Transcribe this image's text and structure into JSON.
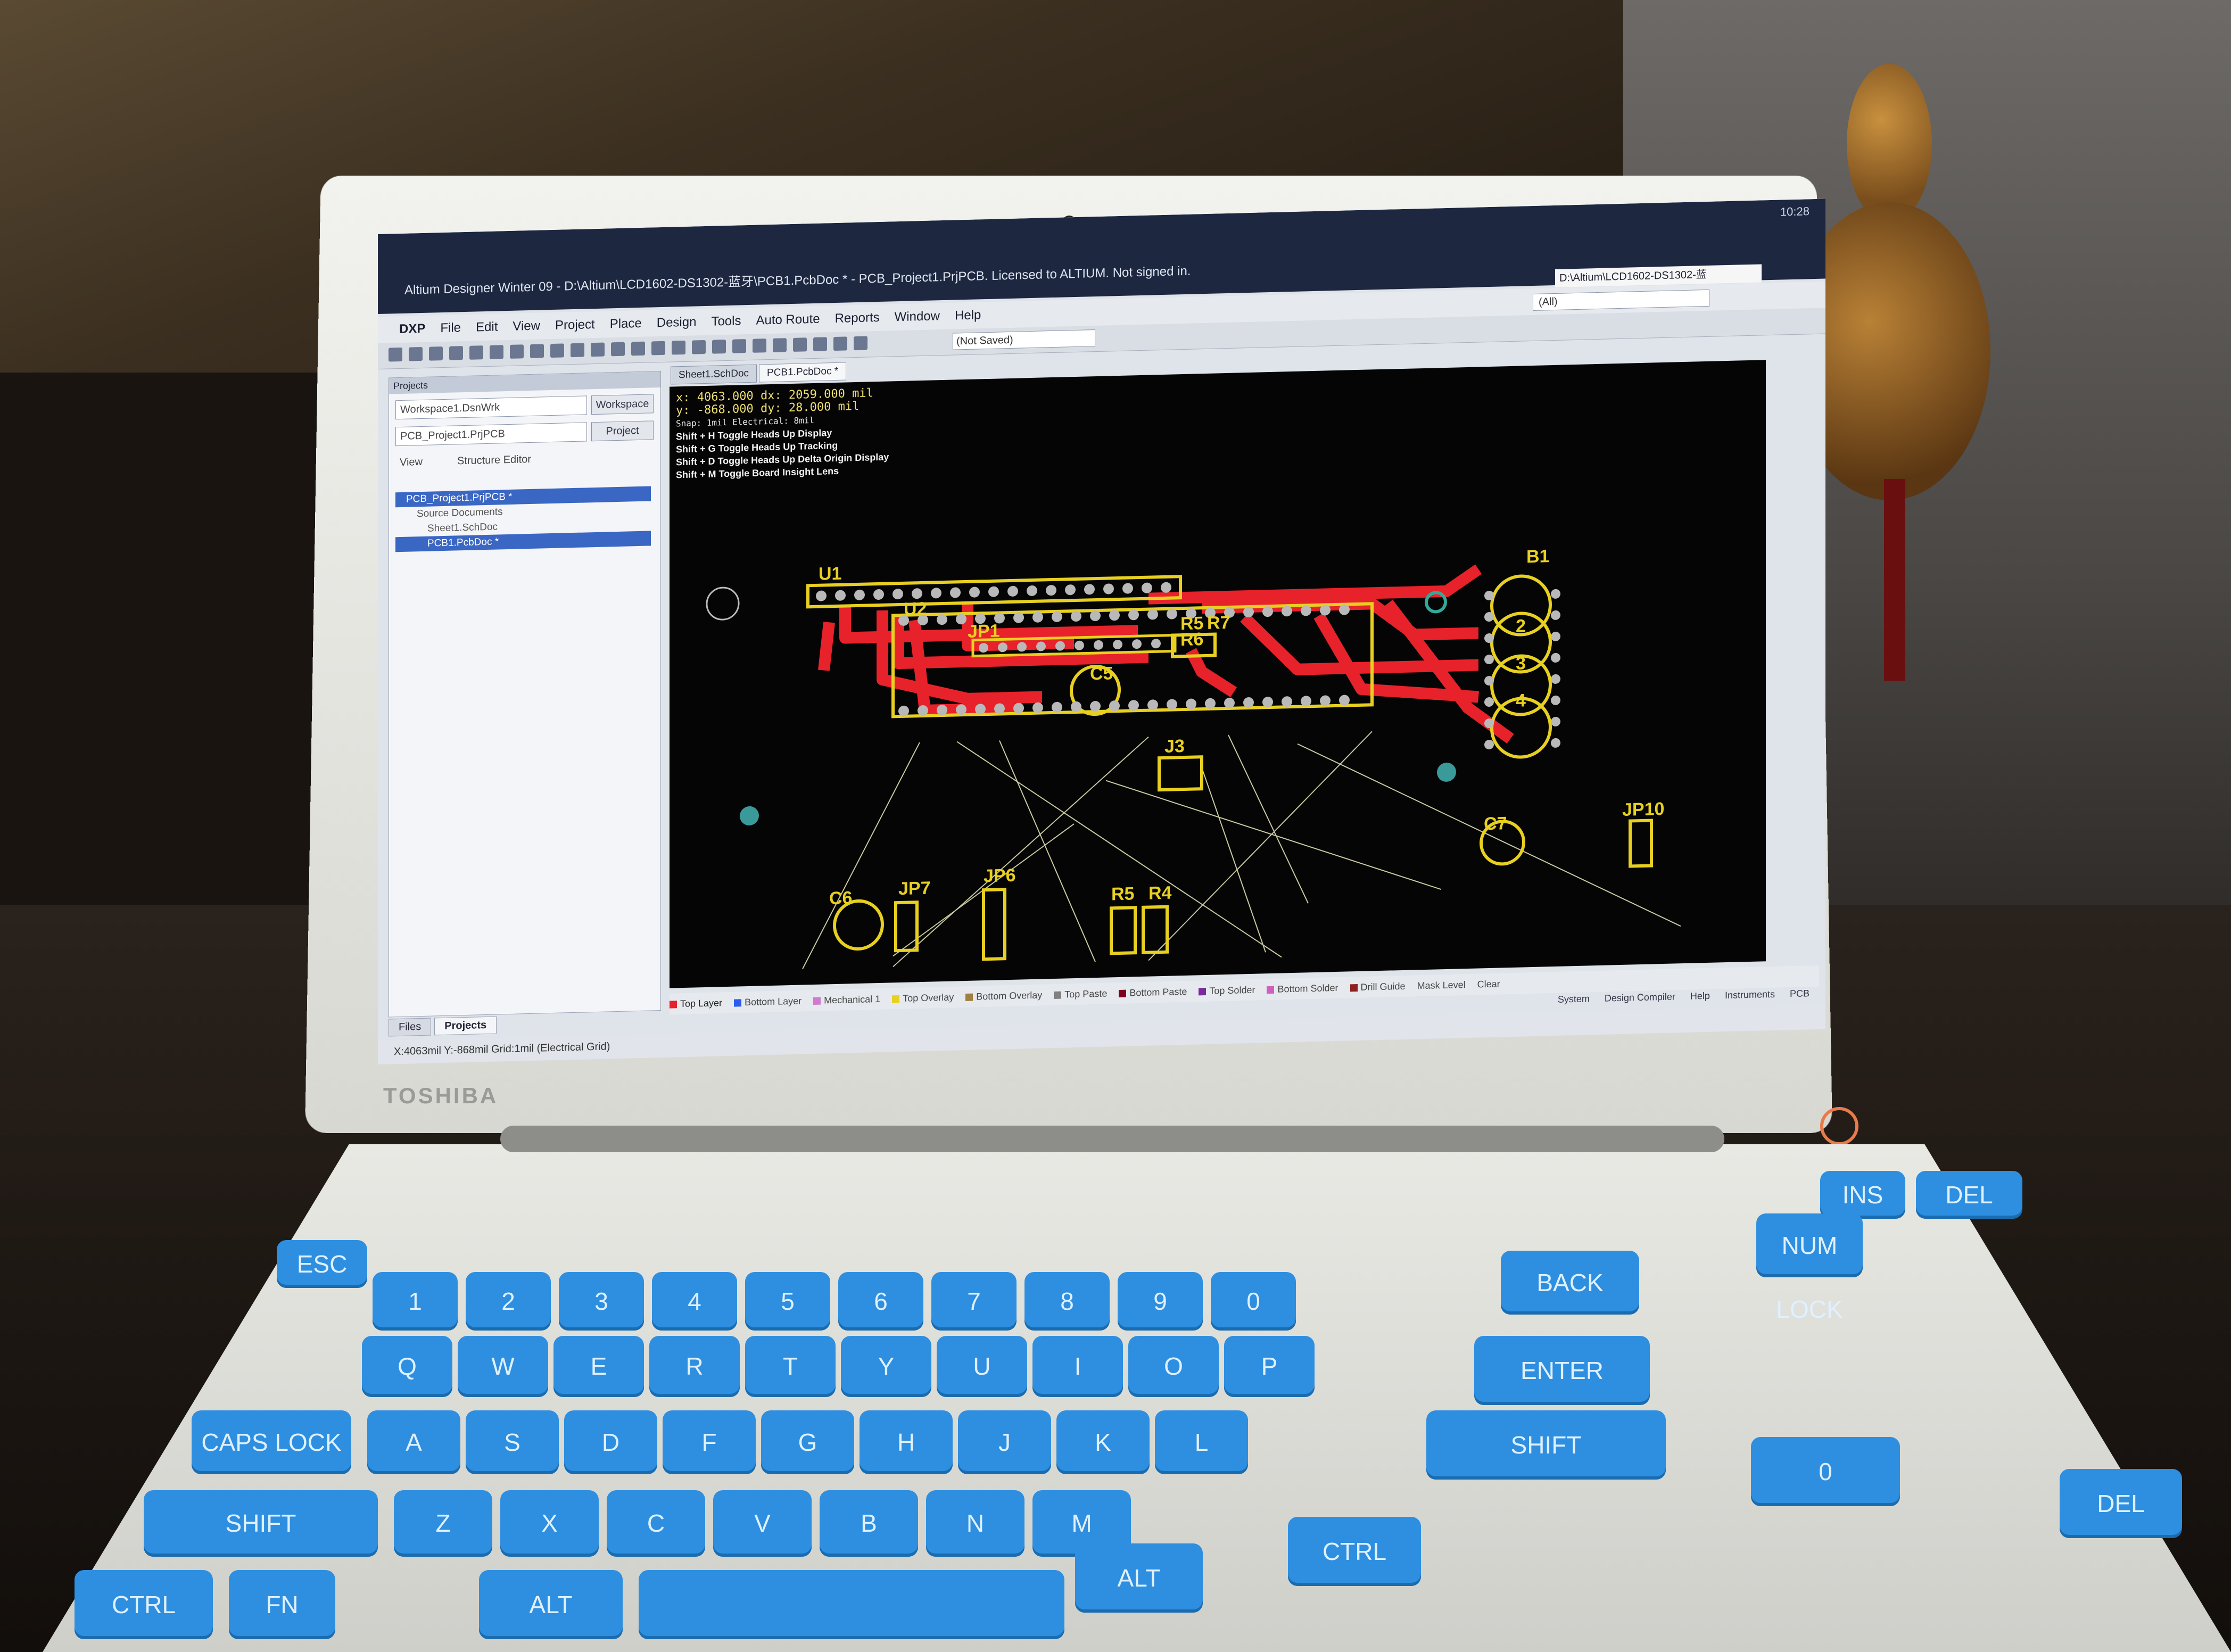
{
  "window": {
    "title": "Altium Designer Winter 09 - D:\\Altium\\LCD1602-DS1302-蓝牙\\PCB1.PcbDoc * - PCB_Project1.PrjPCB. Licensed to ALTIUM. Not signed in.",
    "path_box": "D:\\Altium\\LCD1602-DS1302-蓝",
    "tray_time": "10:28"
  },
  "menu": [
    "DXP",
    "File",
    "Edit",
    "View",
    "Project",
    "Place",
    "Design",
    "Tools",
    "Auto Route",
    "Reports",
    "Window",
    "Help"
  ],
  "toolbar": {
    "not_saved": "(Not Saved)",
    "filter_all": "(All)"
  },
  "panel": {
    "header": "Projects",
    "workspace_field": "Workspace1.DsnWrk",
    "workspace_button": "Workspace",
    "project_field": "PCB_Project1.PrjPCB",
    "project_button": "Project",
    "view_label": "View",
    "structure_editor": "Structure Editor",
    "tree": [
      "PCB_Project1.PrjPCB *",
      "Source Documents",
      "Sheet1.SchDoc",
      "PCB1.PcbDoc *"
    ]
  },
  "bottom_tabs": [
    "Files",
    "Projects"
  ],
  "status_bar": "X:4063mil Y:-868mil   Grid:1mil   (Electrical Grid)",
  "doc_tabs": [
    "Sheet1.SchDoc",
    "PCB1.PcbDoc *"
  ],
  "hud": {
    "line1": "x:  4063.000   dx:  2059.000  mil",
    "line2": "y:  -868.000   dy:    28.000   mil",
    "snap": "Snap: 1mil Electrical: 8mil",
    "hints": [
      "Shift + H  Toggle Heads Up Display",
      "Shift + G  Toggle Heads Up Tracking",
      "Shift + D  Toggle Heads Up Delta Origin Display",
      "Shift + M  Toggle Board Insight Lens"
    ]
  },
  "designators": [
    "U1",
    "U2",
    "JP1",
    "R5",
    "R6",
    "R7",
    "C5",
    "J3",
    "B1",
    "2",
    "3",
    "4",
    "C7",
    "JP10",
    "C6",
    "JP7",
    "JP6",
    "R5",
    "R4"
  ],
  "layers": [
    {
      "name": "Top Layer",
      "color": "#e8222a"
    },
    {
      "name": "Bottom Layer",
      "color": "#2a5cf0"
    },
    {
      "name": "Mechanical 1",
      "color": "#d07ad0"
    },
    {
      "name": "Top Overlay",
      "color": "#e8d020"
    },
    {
      "name": "Bottom Overlay",
      "color": "#a08040"
    },
    {
      "name": "Top Paste",
      "color": "#808080"
    },
    {
      "name": "Bottom Paste",
      "color": "#800020"
    },
    {
      "name": "Top Solder",
      "color": "#7a2aa0"
    },
    {
      "name": "Bottom Solder",
      "color": "#d060c0"
    },
    {
      "name": "Drill Guide",
      "color": "#902020"
    }
  ],
  "layer_bar_right": [
    "Mask Level",
    "Clear"
  ],
  "bottom_links": [
    "System",
    "Design Compiler",
    "Help",
    "Instruments",
    "PCB"
  ],
  "laptop": {
    "brand": "TOSHIBA"
  },
  "keys": {
    "row1": [
      "Q",
      "W",
      "E",
      "R",
      "T",
      "Y",
      "U",
      "I",
      "O",
      "P"
    ],
    "row2": [
      "A",
      "S",
      "D",
      "F",
      "G",
      "H",
      "J",
      "K",
      "L"
    ],
    "row3": [
      "Z",
      "X",
      "C",
      "V",
      "B",
      "N",
      "M"
    ],
    "nums": [
      "1",
      "2",
      "3",
      "4",
      "5",
      "6",
      "7",
      "8",
      "9",
      "0"
    ],
    "enter": "ENTER",
    "shift": "SHIFT",
    "ctrl": "CTRL",
    "alt": "ALT",
    "fn": "FN",
    "caps": "CAPS LOCK",
    "tab": "",
    "esc": "ESC",
    "back": "BACK SPACE",
    "del": "DEL",
    "ins": "INS",
    "numlock": "NUM LOCK"
  },
  "colors": {
    "trace": "#e8222a",
    "overlay": "#e8d020",
    "canvas": "#050505",
    "key": "#2e8fe0"
  }
}
